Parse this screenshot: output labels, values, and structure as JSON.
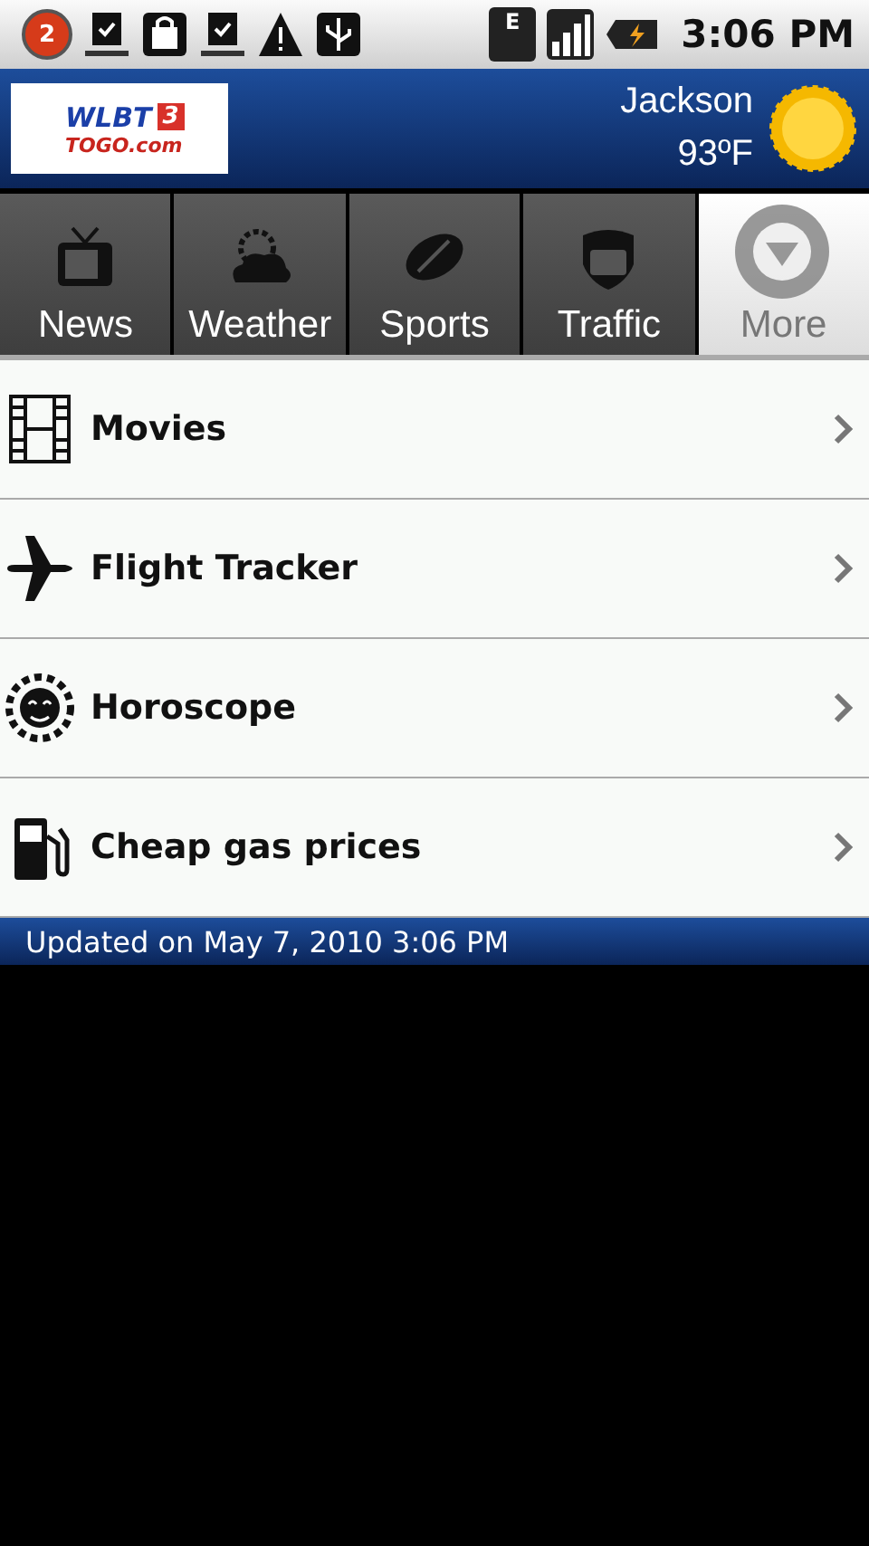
{
  "status_bar": {
    "notification_count": "2",
    "network_type": "E",
    "time": "3:06 PM"
  },
  "header": {
    "logo": {
      "name": "WLBT",
      "channel": "3",
      "site": "TOGO.com"
    },
    "city": "Jackson",
    "temperature": "93ºF"
  },
  "tabs": [
    {
      "label": "News",
      "kind": "tv",
      "selected": false
    },
    {
      "label": "Weather",
      "kind": "weather",
      "selected": false
    },
    {
      "label": "Sports",
      "kind": "football",
      "selected": false
    },
    {
      "label": "Traffic",
      "kind": "route",
      "selected": false
    },
    {
      "label": "More",
      "kind": "more",
      "selected": true
    }
  ],
  "menu": [
    {
      "label": "Movies",
      "kind": "film"
    },
    {
      "label": "Flight Tracker",
      "kind": "plane"
    },
    {
      "label": "Horoscope",
      "kind": "sun"
    },
    {
      "label": "Cheap gas prices",
      "kind": "gas"
    }
  ],
  "footer": {
    "updated": "Updated on May 7, 2010 3:06 PM"
  }
}
